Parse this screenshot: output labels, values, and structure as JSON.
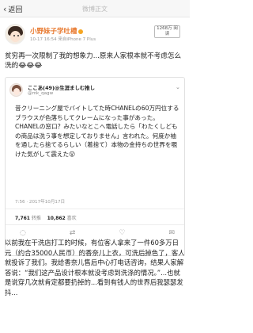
{
  "nav": {
    "back_label": "返回",
    "title": "微博正文"
  },
  "post": {
    "username": "小野妹子学吐槽",
    "time_source": "10-17 16:54  来自iPhone 7 Plus",
    "follow_label": "1268万 阅读"
  },
  "main_text": "贫穷再一次限制了我的想象力...原来人家根本就不考虑怎么洗的😂😂😂",
  "quoted_tweet": {
    "display_name": "ここあ(49)@生涯ましむ推し",
    "handle": "@mk_qagw",
    "text": "昔クリーニング屋でバイトしてた時CHANELの60万円位するブラウスが色落ちしてクレームになった事があった。CHANELの窓口？みたいなとこへ電話したら「わたくしどもの商品は洗う事を想定しておりません」言われた。何度か袖を通したら捨てるらしい（着捨て）本物の金持ちの世界を覗けた気がして震えた😮",
    "time": "7:56 · 2017年10月17日",
    "retweets": "7,761",
    "retweets_label": "转推",
    "likes": "10,862",
    "likes_label": "喜欢"
  },
  "translation_text": "以前我在干洗店打工的时候，有位客人拿来了一件60多万日元（约合35000人民币）的香奈儿上衣，可洗后掉色了，客人就投诉了我们。我给香奈儿售后中心打电话咨询，结果人家解答说：“我们这产品设计根本就没考虑到洗涤的情况。”...也就是说穿几次就肯定都要扔掉的...看到有钱人的世界后我瑟瑟发抖..."
}
